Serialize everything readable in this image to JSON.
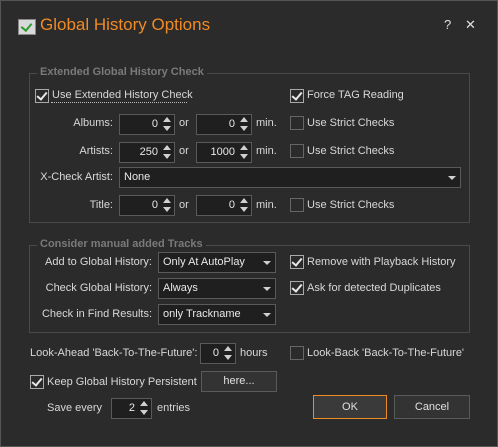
{
  "window": {
    "title": "Global History Options",
    "help_label": "?",
    "close_label": "✕",
    "accent_color": "#f08a24"
  },
  "extended": {
    "group_title": "Extended Global History Check",
    "use_extended_label": "Use Extended History Check",
    "use_extended_checked": true,
    "force_tag_label": "Force TAG Reading",
    "force_tag_checked": true,
    "albums_label": "Albums:",
    "albums_from": "0",
    "albums_to": "0",
    "artists_label": "Artists:",
    "artists_from": "250",
    "artists_to": "1000",
    "xcheck_label": "X-Check Artist:",
    "xcheck_value": "None",
    "title_label": "Title:",
    "title_from": "0",
    "title_to": "0",
    "or_label": "or",
    "min_label": "min.",
    "strict_label": "Use Strict Checks"
  },
  "manual": {
    "group_title": "Consider manual added Tracks",
    "add_label": "Add to Global History:",
    "add_value": "Only At AutoPlay",
    "check_label": "Check Global History:",
    "check_value": "Always",
    "find_label": "Check in Find Results:",
    "find_value": "only Trackname",
    "remove_label": "Remove with Playback History",
    "remove_checked": true,
    "ask_label": "Ask for detected Duplicates",
    "ask_checked": true
  },
  "bottom": {
    "lookahead_label": "Look-Ahead 'Back-To-The-Future':",
    "lookahead_value": "0",
    "hours_label": "hours",
    "lookback_label": "Look-Back 'Back-To-The-Future'",
    "keep_label": "Keep Global History Persistent",
    "keep_checked": true,
    "here_label": "here...",
    "save_every_label": "Save every",
    "save_every_value": "2",
    "entries_label": "entries",
    "ok_label": "OK",
    "cancel_label": "Cancel"
  }
}
